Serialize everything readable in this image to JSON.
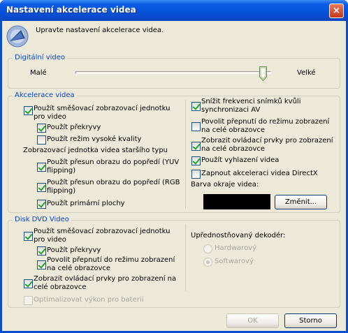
{
  "window": {
    "title": "Nastavení akcelerace videa",
    "close_symbol": "×"
  },
  "intro": "Upravte nastavení akcelerace videa.",
  "digital_video": {
    "label": "Digitální video",
    "slider_min_label": "Malé",
    "slider_max_label": "Velké",
    "slider_level": 1.0
  },
  "acceleration": {
    "label": "Akcelerace videa",
    "use_mixing": {
      "label_line1": "Použít směšovací zobrazovací jednotku",
      "label_line2": "pro video",
      "checked": true
    },
    "use_overlays": {
      "label": "Použít překryvy",
      "checked": true
    },
    "use_high_quality": {
      "label": "Použít režim vysoké kvality",
      "checked": false
    },
    "legacy_heading": "Zobrazovací jednotka videa staršího typu",
    "yuv_flipping": {
      "label_line1": "Použít přesun obrazu do popředí (YUV",
      "label_line2": "flipping)",
      "checked": true
    },
    "rgb_flipping": {
      "label_line1": "Použít přesun obrazu do popředí (RGB",
      "label_line2": "flipping)",
      "checked": true
    },
    "primary_surfaces": {
      "label": "Použít primární plochy",
      "checked": true
    },
    "reduce_framerate": {
      "label_line1": "Snížit frekvenci snímků kvůli",
      "label_line2": "synchronizaci AV",
      "checked": true
    },
    "allow_fullscreen": {
      "label_line1": "Povolit přepnutí do režimu zobrazení",
      "label_line2": "na celé obrazovce",
      "checked": false
    },
    "show_controls": {
      "label_line1": "Zobrazit ovládací prvky pro zobrazení",
      "label_line2": "na celé obrazovce",
      "checked": true
    },
    "use_smoothing": {
      "label": "Použít vyhlazení videa",
      "checked": true
    },
    "enable_directx": {
      "label": "Zapnout akceleraci videa DirectX",
      "checked": false
    },
    "border_color_label": "Barva okraje videa:",
    "border_color": "#000000",
    "change_button": "Změnit..."
  },
  "dvd": {
    "label": "Disk DVD Video",
    "use_mixing": {
      "label_line1": "Použít směšovací zobrazovací jednotku",
      "label_line2": "pro video",
      "checked": true
    },
    "use_overlays": {
      "label": "Použít překryvy",
      "checked": true
    },
    "allow_fullscreen": {
      "label_line1": "Povolit přepnutí do režimu zobrazení",
      "label_line2": "na celé obrazovce",
      "checked": true
    },
    "show_controls": {
      "label_line1": "Zobrazit ovládací prvky pro zobrazení na",
      "label_line2": "celé obrazovce",
      "checked": true
    },
    "optimize_battery": {
      "label": "Optimalizovat výkon pro baterii",
      "checked": false,
      "disabled": true
    },
    "decoder_heading": "Upřednostňovaný dekodér:",
    "decoder_options": [
      {
        "label": "Hardwarový",
        "selected": false
      },
      {
        "label": "Softwarový",
        "selected": true
      }
    ]
  },
  "buttons": {
    "ok": "OK",
    "cancel": "Storno"
  },
  "colors": {
    "title_bar": "#0a5ce6",
    "dialog_bg": "#ece9d8",
    "group_label": "#0046d5",
    "check_mark": "#21a121"
  }
}
